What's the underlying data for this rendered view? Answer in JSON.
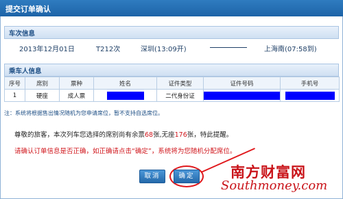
{
  "window": {
    "title": "提交订单确认"
  },
  "train_section": {
    "header": "车次信息",
    "date": "2013年12月01日",
    "train_no": "T212次",
    "depart": "深圳(13:09开)",
    "arrive": "上海南(07:58到)"
  },
  "passenger_section": {
    "header": "乘车人信息",
    "columns": [
      "序号",
      "席别",
      "票种",
      "姓名",
      "证件类型",
      "证件号码",
      "手机号"
    ],
    "rows": [
      {
        "no": "1",
        "seat": "硬座",
        "ticket": "成人票",
        "id_type": "二代身份证"
      }
    ]
  },
  "note": "注：系统将根据售出情况随机为您申请席位，暂不支持自选席位。",
  "message": {
    "part1": "尊敬的旅客，本次列车您选择的席别尚有余票",
    "count1": "68",
    "part2": "张,无座",
    "count2": "176",
    "part3": "张，特此提醒。"
  },
  "warning": "请确认订单信息是否正确，如正确请点击“确定”，系统将为您随机分配席位。",
  "buttons": {
    "cancel": "取消",
    "ok": "确定"
  },
  "watermark": {
    "cn": "南方财富网",
    "en": "Southmoney.com"
  },
  "colors": {
    "titlebar": "#1d63a7",
    "warning": "#d0151b",
    "redaction": "#0000ff"
  }
}
